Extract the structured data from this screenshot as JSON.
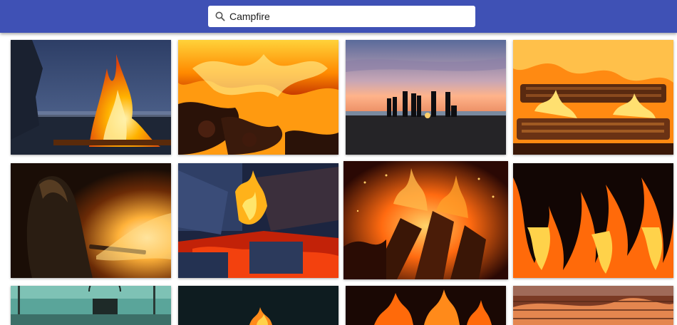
{
  "search": {
    "value": "Campfire",
    "icon": "search-icon"
  },
  "results": [
    {
      "name": "bonfire-at-dusk-by-lake"
    },
    {
      "name": "flames-over-glowing-coals"
    },
    {
      "name": "people-silhouettes-at-beach-sunset"
    },
    {
      "name": "burning-logs-close-up"
    },
    {
      "name": "woman-watching-bonfire"
    },
    {
      "name": "campfire-embers-and-blue-logs"
    },
    {
      "name": "campfire-sparks-in-darkness"
    },
    {
      "name": "flames-on-black-background"
    },
    {
      "name": "cooking-pot-over-fire"
    },
    {
      "name": "small-fire-in-dark"
    },
    {
      "name": "fire-in-night"
    },
    {
      "name": "glowing-grill-fire"
    }
  ],
  "colors": {
    "header": "#3f51b5",
    "background": "#ffffff"
  }
}
